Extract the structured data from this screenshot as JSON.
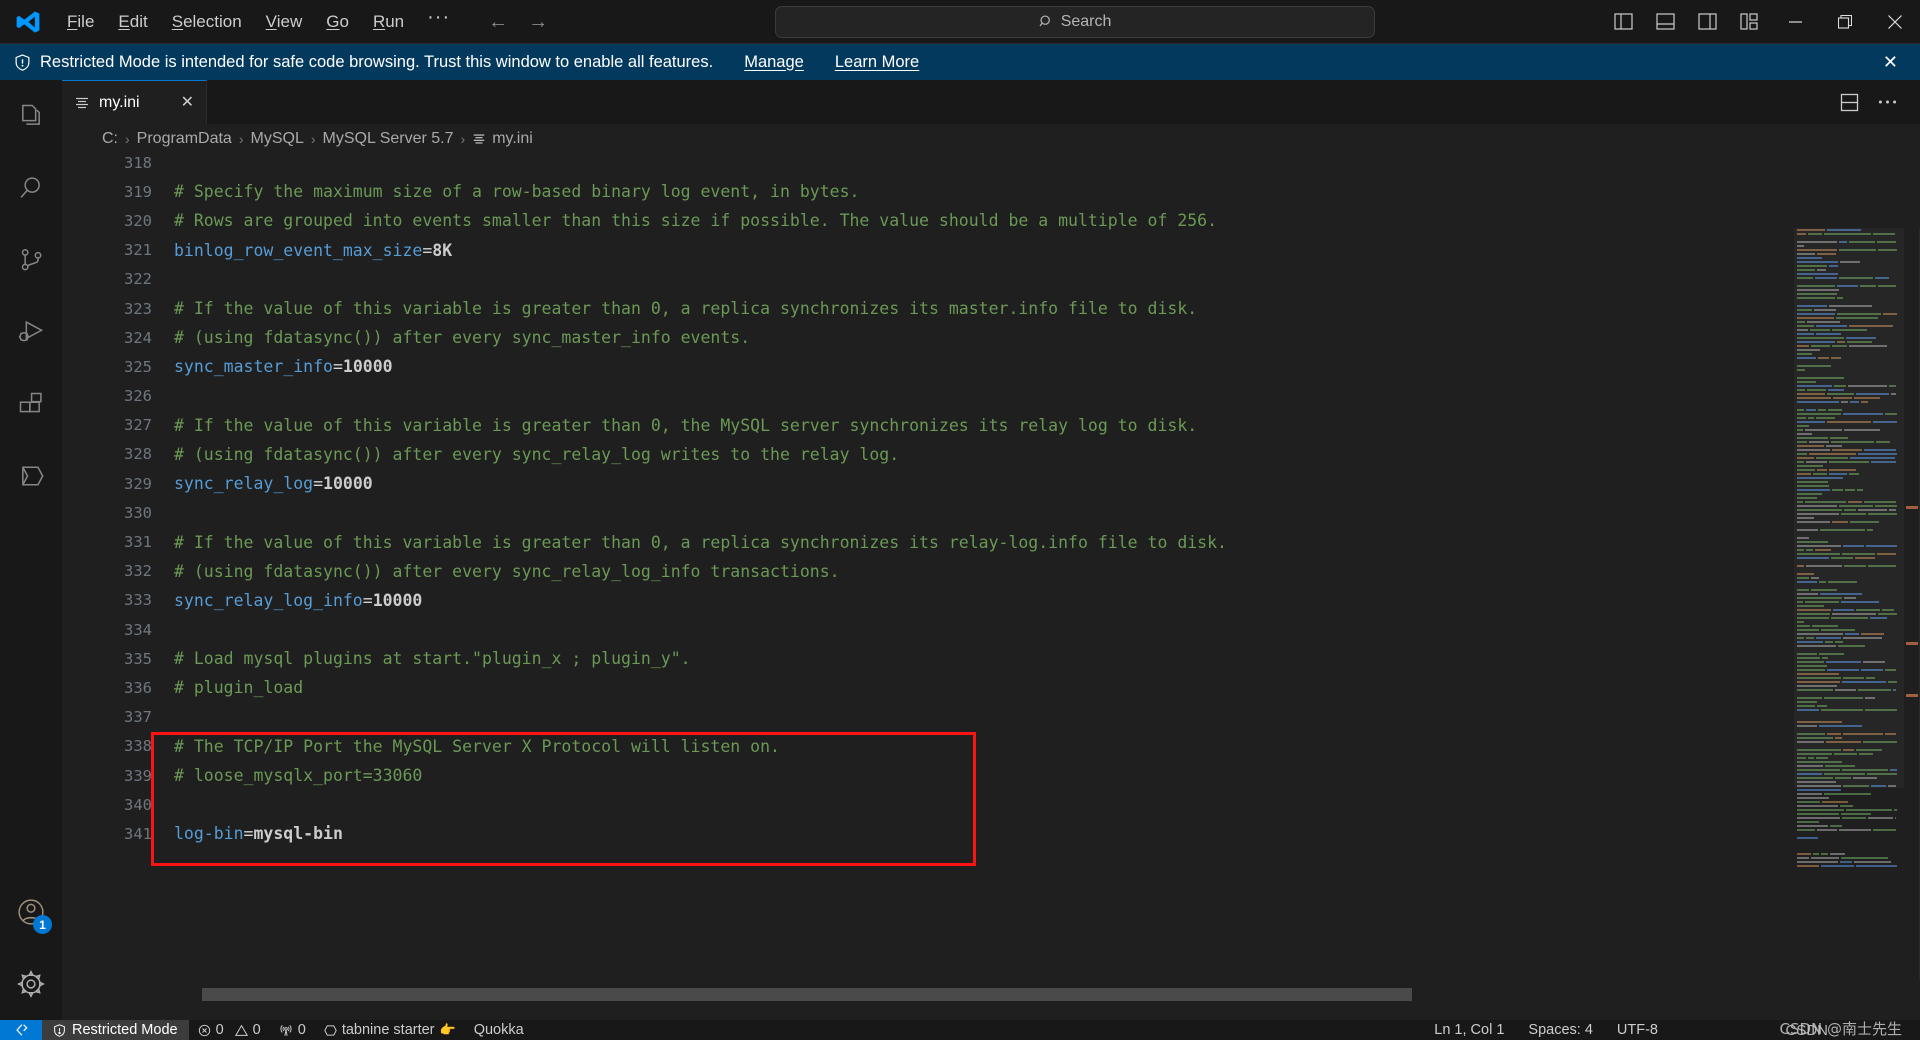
{
  "titlebar": {
    "logo_icon": "vscode-logo",
    "menus": [
      {
        "label": "File",
        "mnemonic": "F"
      },
      {
        "label": "Edit",
        "mnemonic": "E"
      },
      {
        "label": "Selection",
        "mnemonic": "S"
      },
      {
        "label": "View",
        "mnemonic": "V"
      },
      {
        "label": "Go",
        "mnemonic": "G"
      },
      {
        "label": "Run",
        "mnemonic": "R"
      }
    ],
    "more_menus": "···",
    "back_arrow": "←",
    "forward_arrow": "→",
    "search_placeholder": "Search",
    "search_icon": "search-icon",
    "layout_icons": [
      "toggle-primary-sidebar-icon",
      "toggle-panel-icon",
      "toggle-secondary-sidebar-icon",
      "customize-layout-icon"
    ],
    "window_minimize": "–",
    "window_maximize": "❐",
    "window_close": "✕"
  },
  "banner": {
    "icon": "shield-icon",
    "message": "Restricted Mode is intended for safe code browsing. Trust this window to enable all features.",
    "manage_link": "Manage",
    "learn_more_link": "Learn More",
    "close": "✕"
  },
  "activitybar": {
    "items": [
      {
        "name": "explorer",
        "icon": "files-icon",
        "active": false
      },
      {
        "name": "search",
        "icon": "search-icon",
        "active": false
      },
      {
        "name": "source-control",
        "icon": "source-control-icon",
        "active": false
      },
      {
        "name": "run-and-debug",
        "icon": "run-debug-icon",
        "active": false
      },
      {
        "name": "extensions",
        "icon": "extensions-icon",
        "active": false
      },
      {
        "name": "quokka",
        "icon": "hexagon-icon",
        "active": false
      }
    ],
    "bottom": [
      {
        "name": "accounts",
        "icon": "account-icon",
        "badge": "1"
      },
      {
        "name": "settings",
        "icon": "gear-icon",
        "badge": ""
      }
    ]
  },
  "editor": {
    "tab": {
      "label": "my.ini",
      "icon": "ini-file-icon",
      "close": "✕"
    },
    "tab_actions": [
      "split-editor-down-icon",
      "more-actions-icon"
    ],
    "breadcrumb": [
      "C:",
      "ProgramData",
      "MySQL",
      "MySQL Server 5.7",
      "my.ini"
    ],
    "breadcrumb_separator": "›",
    "first_partial_line": "318",
    "lines": [
      {
        "n": "319",
        "tokens": [
          {
            "t": "comment",
            "v": "# Specify the maximum size of a row-based binary log event, in bytes."
          }
        ]
      },
      {
        "n": "320",
        "tokens": [
          {
            "t": "comment",
            "v": "# Rows are grouped into events smaller than this size if possible. The value should be a multiple of 256."
          }
        ]
      },
      {
        "n": "321",
        "tokens": [
          {
            "t": "key",
            "v": "binlog_row_event_max_size"
          },
          {
            "t": "eq",
            "v": "="
          },
          {
            "t": "val",
            "v": "8K"
          }
        ]
      },
      {
        "n": "322",
        "tokens": []
      },
      {
        "n": "323",
        "tokens": [
          {
            "t": "comment",
            "v": "# If the value of this variable is greater than 0, a replica synchronizes its master.info file to disk."
          }
        ]
      },
      {
        "n": "324",
        "tokens": [
          {
            "t": "comment",
            "v": "# (using fdatasync()) after every sync_master_info events."
          }
        ]
      },
      {
        "n": "325",
        "tokens": [
          {
            "t": "key",
            "v": "sync_master_info"
          },
          {
            "t": "eq",
            "v": "="
          },
          {
            "t": "val",
            "v": "10000"
          }
        ]
      },
      {
        "n": "326",
        "tokens": []
      },
      {
        "n": "327",
        "tokens": [
          {
            "t": "comment",
            "v": "# If the value of this variable is greater than 0, the MySQL server synchronizes its relay log to disk."
          }
        ]
      },
      {
        "n": "328",
        "tokens": [
          {
            "t": "comment",
            "v": "# (using fdatasync()) after every sync_relay_log writes to the relay log."
          }
        ]
      },
      {
        "n": "329",
        "tokens": [
          {
            "t": "key",
            "v": "sync_relay_log"
          },
          {
            "t": "eq",
            "v": "="
          },
          {
            "t": "val",
            "v": "10000"
          }
        ]
      },
      {
        "n": "330",
        "tokens": []
      },
      {
        "n": "331",
        "tokens": [
          {
            "t": "comment",
            "v": "# If the value of this variable is greater than 0, a replica synchronizes its relay-log.info file to disk."
          }
        ]
      },
      {
        "n": "332",
        "tokens": [
          {
            "t": "comment",
            "v": "# (using fdatasync()) after every sync_relay_log_info transactions."
          }
        ]
      },
      {
        "n": "333",
        "tokens": [
          {
            "t": "key",
            "v": "sync_relay_log_info"
          },
          {
            "t": "eq",
            "v": "="
          },
          {
            "t": "val",
            "v": "10000"
          }
        ]
      },
      {
        "n": "334",
        "tokens": []
      },
      {
        "n": "335",
        "tokens": [
          {
            "t": "comment",
            "v": "# Load mysql plugins at start.\"plugin_x ; plugin_y\"."
          }
        ]
      },
      {
        "n": "336",
        "tokens": [
          {
            "t": "comment",
            "v": "# plugin_load"
          }
        ]
      },
      {
        "n": "337",
        "tokens": []
      },
      {
        "n": "338",
        "tokens": [
          {
            "t": "comment",
            "v": "# The TCP/IP Port the MySQL Server X Protocol will listen on."
          }
        ]
      },
      {
        "n": "339",
        "tokens": [
          {
            "t": "comment",
            "v": "# loose_mysqlx_port=33060"
          }
        ]
      },
      {
        "n": "340",
        "tokens": []
      },
      {
        "n": "341",
        "tokens": [
          {
            "t": "key",
            "v": "log-bin"
          },
          {
            "t": "eq",
            "v": "="
          },
          {
            "t": "val",
            "v": "mysql-bin"
          }
        ]
      }
    ],
    "annotation": {
      "shape": "rectangle",
      "color": "#fc1414",
      "covers_lines": [
        "337",
        "338",
        "339",
        "340",
        "341"
      ]
    }
  },
  "statusbar": {
    "remote_icon": "remote-window-icon",
    "trust": {
      "icon": "shield-icon",
      "label": "Restricted Mode"
    },
    "problems": {
      "errors_icon": "error-icon",
      "errors": "0",
      "warnings_icon": "warning-icon",
      "warnings": "0"
    },
    "radio_icon": "radio-tower-icon",
    "radio_count": "0",
    "tabnine": {
      "icon": "tabnine-icon",
      "label": "tabnine starter",
      "emoji": "👉"
    },
    "quokka": "Quokka",
    "cursor_position": "Ln 1, Col 1",
    "indentation": "Spaces: 4",
    "encoding": "UTF-8",
    "watermark": "CSDN @南士先生",
    "watermark_overlay": "CSDN"
  },
  "colors": {
    "accent": "#0078d4",
    "banner_bg": "#04395e",
    "editor_bg": "#1f1f1f",
    "chrome_bg": "#181818",
    "comment": "#6a9955",
    "key": "#569cd6",
    "annotation": "#fc1414"
  }
}
